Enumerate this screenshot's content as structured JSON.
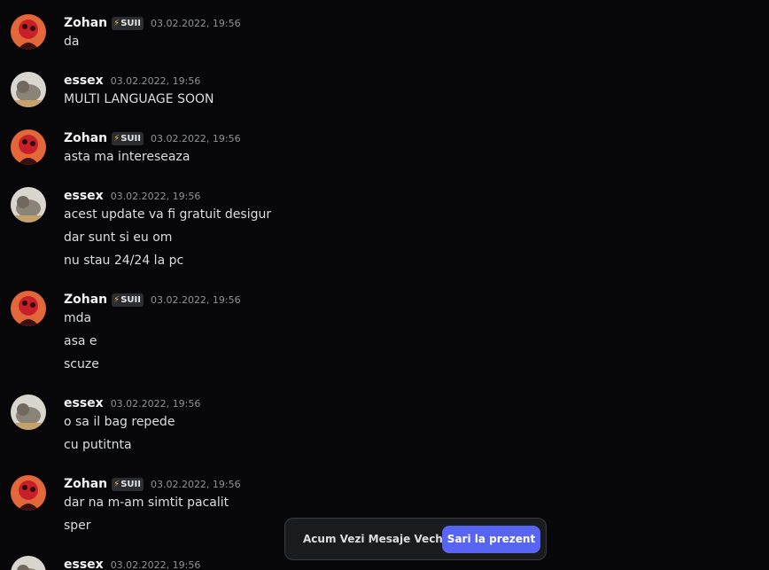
{
  "users": {
    "zohan": {
      "name": "Zohan",
      "tag": "SUII",
      "tag_icon": "lightning-bolt-icon"
    },
    "essex": {
      "name": "essex"
    }
  },
  "messages": [
    {
      "author": "Zohan",
      "tag": "SUII",
      "timestamp": "03.02.2022, 19:56",
      "lines": [
        "da"
      ]
    },
    {
      "author": "essex",
      "timestamp": "03.02.2022, 19:56",
      "lines": [
        "MULTI LANGUAGE SOON"
      ]
    },
    {
      "author": "Zohan",
      "tag": "SUII",
      "timestamp": "03.02.2022, 19:56",
      "lines": [
        "asta ma intereseaza"
      ]
    },
    {
      "author": "essex",
      "timestamp": "03.02.2022, 19:56",
      "lines": [
        "acest update va fi gratuit desigur",
        "dar sunt si eu om",
        "nu stau 24/24 la pc"
      ]
    },
    {
      "author": "Zohan",
      "tag": "SUII",
      "timestamp": "03.02.2022, 19:56",
      "lines": [
        "mda",
        "asa e",
        "scuze"
      ]
    },
    {
      "author": "essex",
      "timestamp": "03.02.2022, 19:56",
      "lines": [
        "o sa il bag repede",
        "cu putitnta"
      ]
    },
    {
      "author": "Zohan",
      "tag": "SUII",
      "timestamp": "03.02.2022, 19:56",
      "lines": [
        "dar na m-am simtit pacalit",
        "sper"
      ]
    },
    {
      "author": "essex",
      "timestamp": "03.02.2022, 19:56",
      "lines": []
    }
  ],
  "jump_bar": {
    "text": "Acum Vezi Mesaje Vechi",
    "button_label": "Sari la prezent"
  },
  "colors": {
    "background": "#070709",
    "accent": "#5865f2",
    "username": "#f2f3f5",
    "text": "#dbdee1",
    "timestamp": "#8e9297"
  }
}
